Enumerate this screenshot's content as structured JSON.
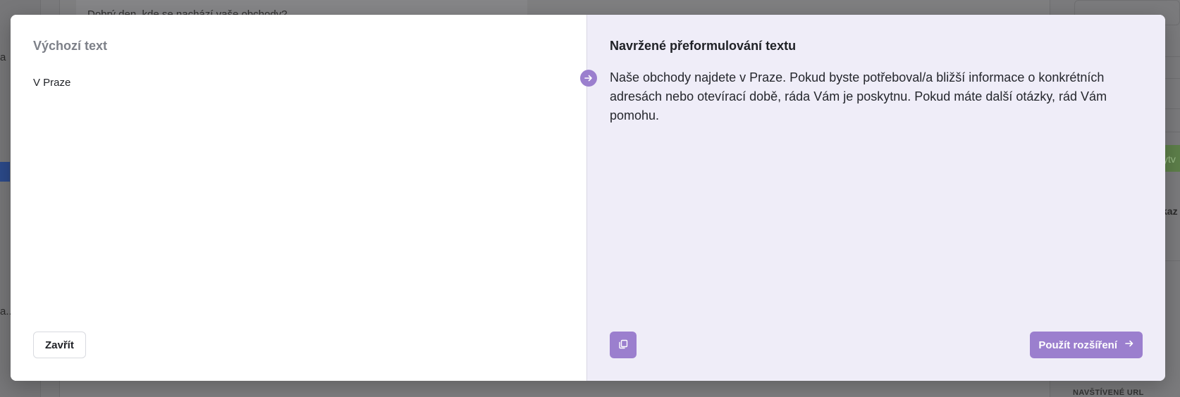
{
  "background": {
    "left_fragment_1": "a",
    "left_fragment_2": "a...",
    "message_preview": "Dobrý den, kde se nachází vaše obchody?",
    "right_button_fragment": "ytv",
    "right_label_fragment": "kaz",
    "right_section_label": "NAVŠTÍVENÉ URL"
  },
  "dialog": {
    "original": {
      "title": "Výchozí text",
      "text": "V Praze",
      "close_label": "Zavřít"
    },
    "suggestion": {
      "title": "Navržené přeformulování textu",
      "text": "Naše obchody najdete v Praze. Pokud byste potřeboval/a bližší informace o konkrétních adresách nebo otevírací době, ráda Vám je poskytnu. Pokud máte další otázky, rád Vám pomohu.",
      "apply_label": "Použít rozšíření"
    },
    "icons": {
      "arrow_badge": "arrow-right-circle-icon",
      "copy": "copy-icon",
      "apply": "arrow-right-icon"
    },
    "colors": {
      "accent": "#9b7fce",
      "suggestion_bg": "#efedf8"
    }
  }
}
